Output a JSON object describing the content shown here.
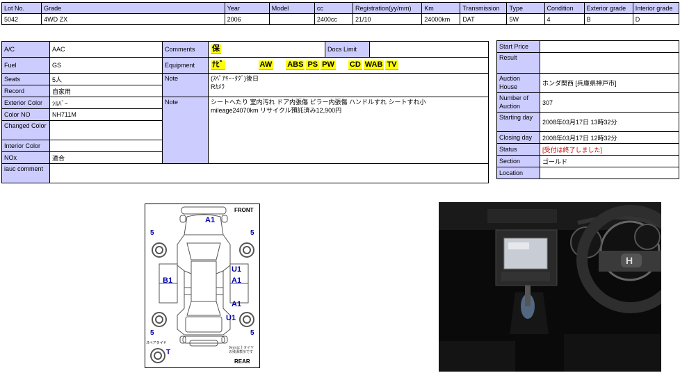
{
  "lot": {
    "headers": [
      "Lot No.",
      "Grade",
      "Year",
      "Model",
      "cc",
      "Registration(yy/mm)",
      "Km",
      "Transmission",
      "Type",
      "Condition",
      "Exterior grade",
      "Interior grade"
    ],
    "values": [
      "5042",
      "4WD ZX",
      "2006",
      "",
      "2400cc",
      "21/10",
      "24000km",
      "DAT",
      "5W",
      "4",
      "B",
      "D"
    ]
  },
  "details": {
    "ac_label": "A/C",
    "ac_value": "AAC",
    "comments_label": "Comments",
    "comments_badge": "保",
    "docs_limit_label": "Docs Limit",
    "docs_limit_value": "",
    "fuel_label": "Fuel",
    "fuel_value": "GS",
    "equipment_label": "Equipment",
    "equipment_badges": [
      "ﾅﾋﾞ",
      "AW",
      "ABS",
      "PS",
      "PW",
      "CD",
      "WAB",
      "TV"
    ],
    "seats_label": "Seats",
    "seats_value": "5人",
    "note_label": "Note",
    "note1_line1": "(ｽﾍﾟｱｷｰ･ﾀｸﾞ)後日",
    "note1_line2": "Rｶﾒﾗ",
    "record_label": "Record",
    "record_value": "自家用",
    "exterior_color_label": "Exterior Color",
    "exterior_color_value": "ｼﾙﾊﾞｰ",
    "note2_label": "Note",
    "note2_line1": "シートへたり 室内汚れ ドア内張傷 ピラー内張傷 ハンドルすれ シートすれ小",
    "note2_line2": "mileage24070km リサイクル預託済み12,900円",
    "color_no_label": "Color NO",
    "color_no_value": "NH711M",
    "changed_color_label": "Changed Color",
    "changed_color_value": "",
    "interior_color_label": "Interior Color",
    "interior_color_value": "",
    "nox_label": "NOx",
    "nox_value": "適合",
    "iauc_comment_label": "iauc comment",
    "iauc_comment_value": ""
  },
  "auction": {
    "start_price_label": "Start Price",
    "start_price_value": "",
    "result_label": "Result",
    "result_value": "",
    "house_label": "Auction House",
    "house_value": "ホンダ関西 [兵庫県神戸市]",
    "number_label": "Number of Auction",
    "number_value": "307",
    "starting_day_label": "Starting day",
    "starting_day_value": "2008年03月17日 13時32分",
    "closing_day_label": "Closing day",
    "closing_day_value": "2008年03月17日 12時32分",
    "status_label": "Status",
    "status_value": "[受付は終了しました]",
    "section_label": "Section",
    "section_value": "ゴールド",
    "location_label": "Location",
    "location_value": "",
    "status_color": "#cc0000"
  },
  "inspection": {
    "front_label": "FRONT",
    "rear_label": "REAR",
    "marks": [
      "A1",
      "B1",
      "U1",
      "A1",
      "A1",
      "U1"
    ],
    "tire_grades": [
      "5",
      "5",
      "5",
      "5"
    ],
    "spare_grade": "T",
    "spare_label": "スペアタイヤ",
    "tire_note": "9mm以上タイヤの残溝表示です"
  },
  "colors": {
    "label_bg": "#ccccff",
    "badge_bg": "#ffff00",
    "diagram_blue": "#0000aa"
  }
}
